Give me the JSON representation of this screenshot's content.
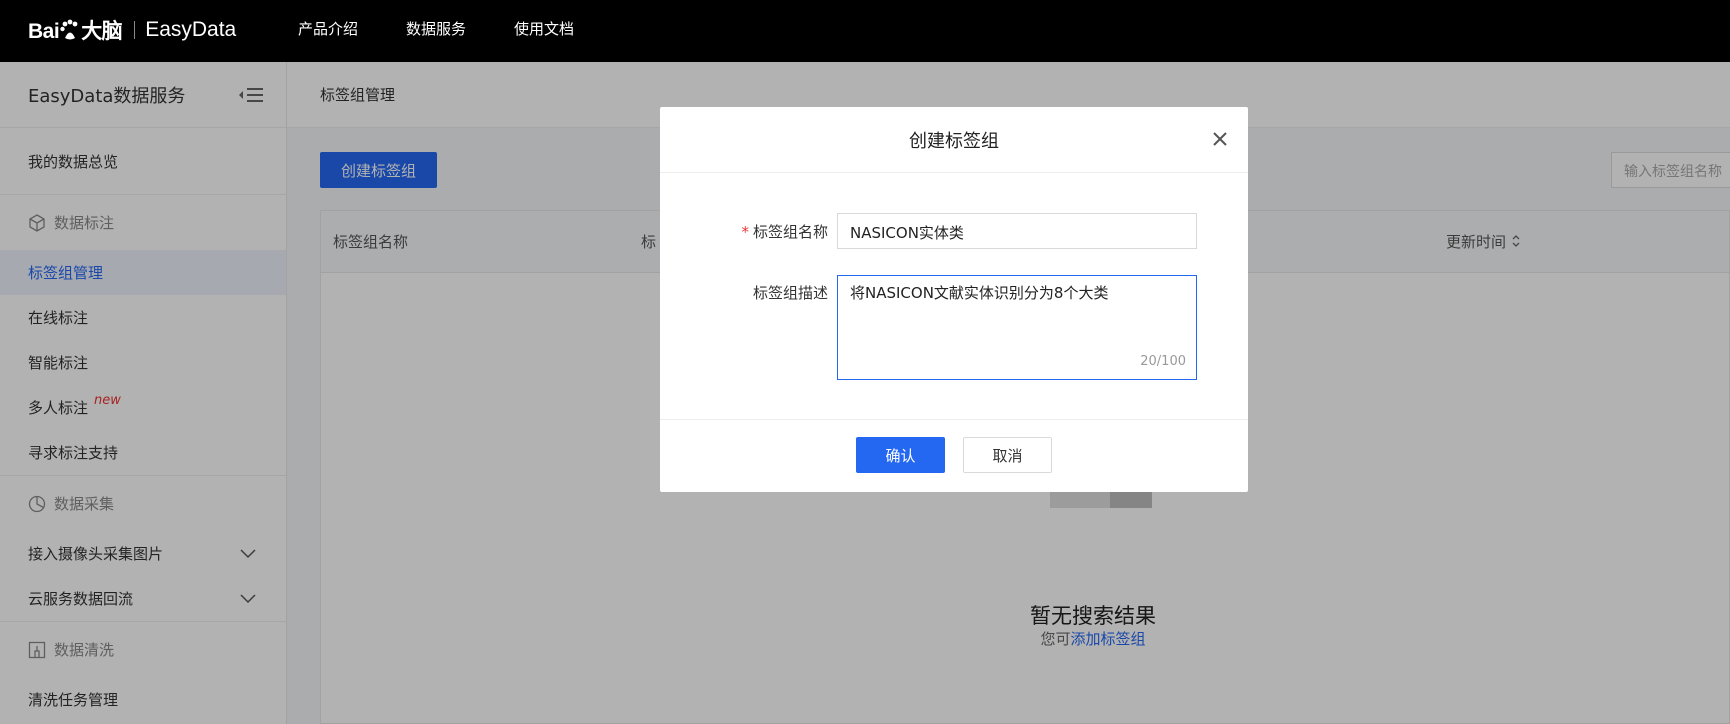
{
  "topbar": {
    "logo_text": "Bai du 大脑",
    "product_name": "EasyData",
    "nav": [
      "产品介绍",
      "数据服务",
      "使用文档"
    ]
  },
  "sidebar": {
    "title": "EasyData数据服务",
    "overview": "我的数据总览",
    "groups": [
      {
        "label": "数据标注",
        "items": [
          "标签组管理",
          "在线标注",
          "智能标注",
          "多人标注",
          "寻求标注支持"
        ]
      },
      {
        "label": "数据采集",
        "items": [
          "接入摄像头采集图片",
          "云服务数据回流"
        ]
      },
      {
        "label": "数据清洗",
        "items": [
          "清洗任务管理"
        ]
      }
    ],
    "new_tag": "new",
    "active_item": "标签组管理"
  },
  "main": {
    "breadcrumb": "标签组管理",
    "create_button": "创建标签组",
    "search_placeholder": "输入标签组名称",
    "columns": [
      "标签组名称",
      "标",
      "更新时间"
    ],
    "empty_title": "暂无搜索结果",
    "empty_sub_prefix": "您可",
    "empty_sub_link": "添加标签组"
  },
  "modal": {
    "title": "创建标签组",
    "name_label": "标签组名称",
    "name_value": "NASICON实体类",
    "desc_label": "标签组描述",
    "desc_value": "将NASICON文献实体识别分为8个大类",
    "desc_count": "20/100",
    "confirm": "确认",
    "cancel": "取消"
  },
  "colors": {
    "accent": "#2468f2",
    "topbar": "#000000",
    "required": "#e33333"
  }
}
